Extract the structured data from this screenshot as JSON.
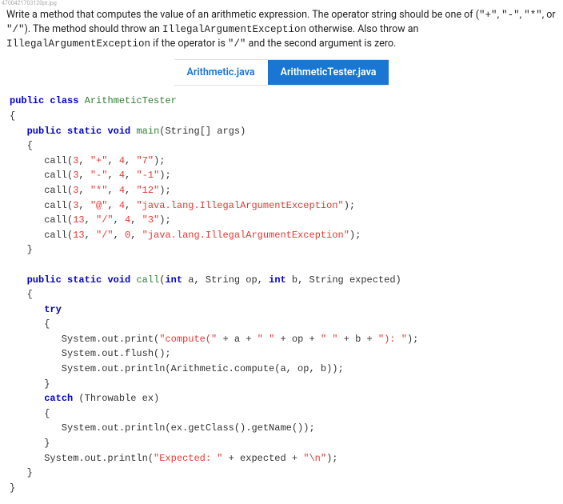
{
  "tiny_header": "4700421703120pt.jpg",
  "description": {
    "part1": "Write a method that computes the value of an arithmetic expression. The operator string should be one of (",
    "op1": "\"+\"",
    "comma1": ", ",
    "op2": "\"-\"",
    "comma2": ", ",
    "op3": "\"*\"",
    "comma3": ", or ",
    "op4": "\"/\"",
    "part2": "). The method should throw an ",
    "exc1": "IllegalArgumentException",
    "part3": " otherwise. Also throw an ",
    "exc2": "IllegalArgumentException",
    "part4": " if the operator is ",
    "divop": "\"/\"",
    "part5": " and the second argument is zero."
  },
  "tabs": {
    "left": "Arithmetic.java",
    "right": "ArithmeticTester.java"
  },
  "code": {
    "l01a": "public",
    "l01b": " ",
    "l01c": "class",
    "l01d": " ",
    "l01e": "ArithmeticTester",
    "l02": "{",
    "l03a": "   ",
    "l03b": "public",
    "l03c": " ",
    "l03d": "static",
    "l03e": " ",
    "l03f": "void",
    "l03g": " ",
    "l03h": "main",
    "l03i": "(String[] args)",
    "l04": "   {",
    "l05a": "      call(",
    "l05b": "3",
    "l05c": ", ",
    "l05d": "\"+\"",
    "l05e": ", ",
    "l05f": "4",
    "l05g": ", ",
    "l05h": "\"7\"",
    "l05i": ");",
    "l06a": "      call(",
    "l06b": "3",
    "l06c": ", ",
    "l06d": "\"-\"",
    "l06e": ", ",
    "l06f": "4",
    "l06g": ", ",
    "l06h": "\"-1\"",
    "l06i": ");",
    "l07a": "      call(",
    "l07b": "3",
    "l07c": ", ",
    "l07d": "\"*\"",
    "l07e": ", ",
    "l07f": "4",
    "l07g": ", ",
    "l07h": "\"12\"",
    "l07i": ");",
    "l08a": "      call(",
    "l08b": "3",
    "l08c": ", ",
    "l08d": "\"@\"",
    "l08e": ", ",
    "l08f": "4",
    "l08g": ", ",
    "l08h": "\"java.lang.IllegalArgumentException\"",
    "l08i": ");",
    "l09a": "      call(",
    "l09b": "13",
    "l09c": ", ",
    "l09d": "\"/\"",
    "l09e": ", ",
    "l09f": "4",
    "l09g": ", ",
    "l09h": "\"3\"",
    "l09i": ");",
    "l10a": "      call(",
    "l10b": "13",
    "l10c": ", ",
    "l10d": "\"/\"",
    "l10e": ", ",
    "l10f": "0",
    "l10g": ", ",
    "l10h": "\"java.lang.IllegalArgumentException\"",
    "l10i": ");",
    "l11": "   }",
    "blank1": "",
    "l12a": "   ",
    "l12b": "public",
    "l12c": " ",
    "l12d": "static",
    "l12e": " ",
    "l12f": "void",
    "l12g": " ",
    "l12h": "call",
    "l12i": "(",
    "l12j": "int",
    "l12k": " a, String op, ",
    "l12l": "int",
    "l12m": " b, String expected)",
    "l13": "   {",
    "l14a": "      ",
    "l14b": "try",
    "l15": "      {",
    "l16a": "         System.out.print(",
    "l16b": "\"compute(\"",
    "l16c": " + a + ",
    "l16d": "\" \"",
    "l16e": " + op + ",
    "l16f": "\" \"",
    "l16g": " + b + ",
    "l16h": "\"): \"",
    "l16i": ");",
    "l17": "         System.out.flush();",
    "l18": "         System.out.println(Arithmetic.compute(a, op, b));",
    "l19": "      }",
    "l20a": "      ",
    "l20b": "catch",
    "l20c": " (Throwable ex)",
    "l21": "      {",
    "l22": "         System.out.println(ex.getClass().getName());",
    "l23": "      }",
    "l24a": "      System.out.println(",
    "l24b": "\"Expected: \"",
    "l24c": " + expected + ",
    "l24d": "\"\\n\"",
    "l24e": ");",
    "l25": "   }",
    "l26": "}"
  }
}
